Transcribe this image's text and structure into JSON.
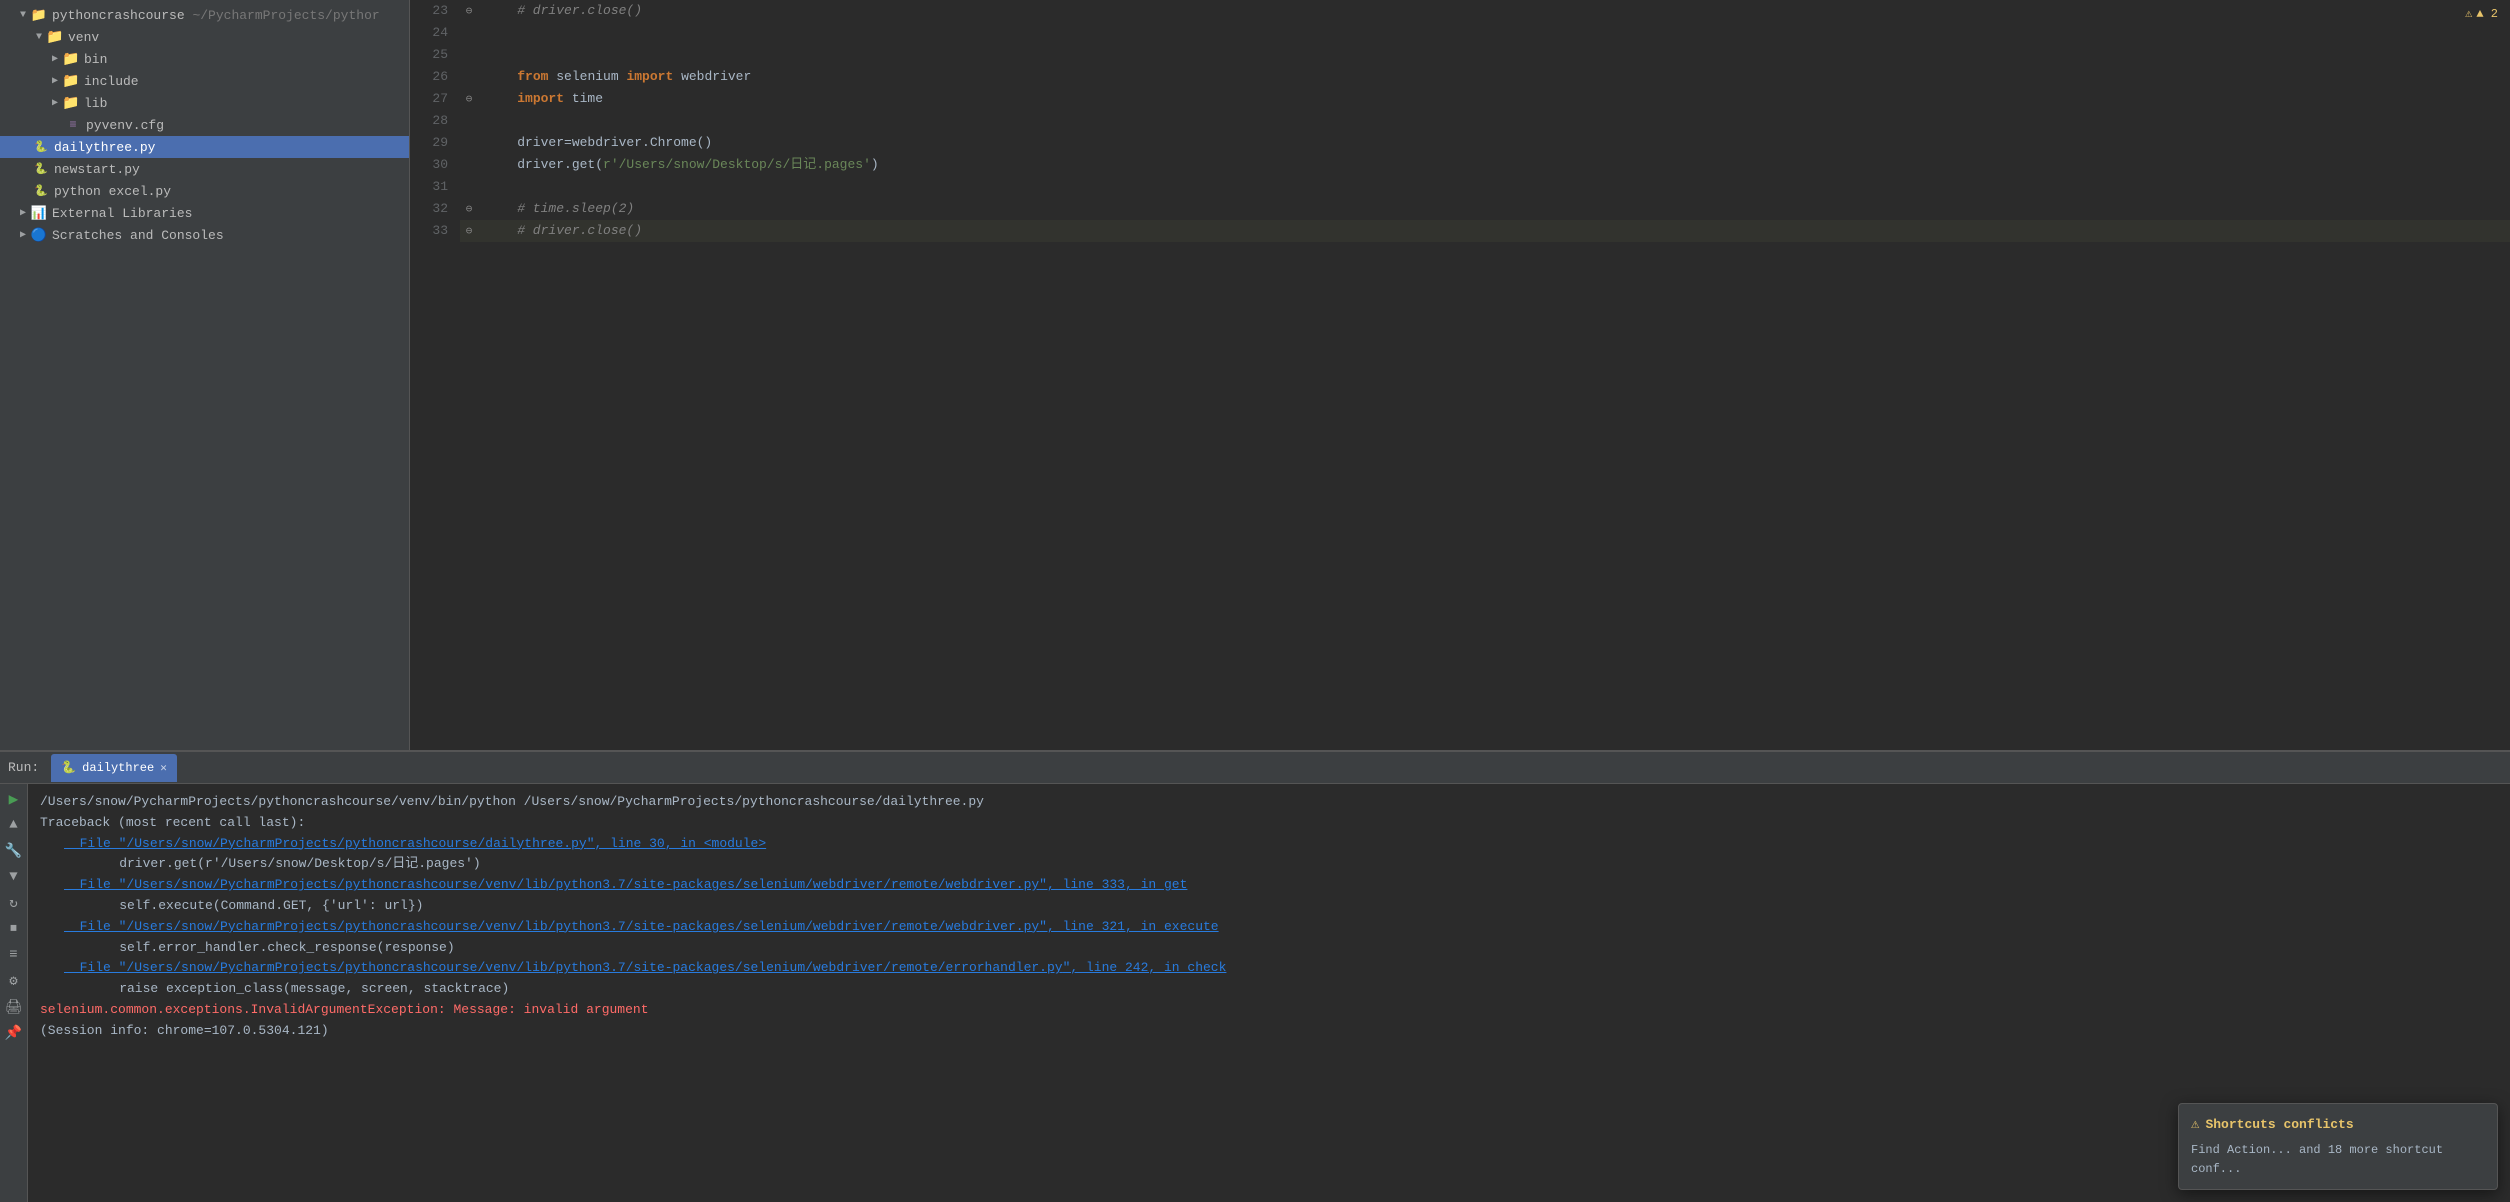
{
  "sidebar": {
    "project_name": "pythoncrashcourse",
    "project_path": "~/PycharmProjects/pythor",
    "items": [
      {
        "id": "pythoncrashcourse",
        "label": "pythoncrashcourse",
        "type": "project",
        "indent": 0,
        "expanded": true
      },
      {
        "id": "venv",
        "label": "venv",
        "type": "folder",
        "indent": 1,
        "expanded": true
      },
      {
        "id": "bin",
        "label": "bin",
        "type": "folder",
        "indent": 2,
        "expanded": false
      },
      {
        "id": "include",
        "label": "include",
        "type": "folder",
        "indent": 2,
        "expanded": false
      },
      {
        "id": "lib",
        "label": "lib",
        "type": "folder",
        "indent": 2,
        "expanded": false
      },
      {
        "id": "pyvenv.cfg",
        "label": "pyvenv.cfg",
        "type": "cfg",
        "indent": 2,
        "expanded": false
      },
      {
        "id": "dailythree.py",
        "label": "dailythree.py",
        "type": "py",
        "indent": 1,
        "active": true
      },
      {
        "id": "newstart.py",
        "label": "newstart.py",
        "type": "py",
        "indent": 1
      },
      {
        "id": "python excel.py",
        "label": "python excel.py",
        "type": "py",
        "indent": 1
      },
      {
        "id": "External Libraries",
        "label": "External Libraries",
        "type": "lib",
        "indent": 0,
        "expanded": false
      },
      {
        "id": "Scratches and Consoles",
        "label": "Scratches and Consoles",
        "type": "scratch",
        "indent": 0,
        "expanded": false
      }
    ]
  },
  "editor": {
    "lines": [
      {
        "num": 23,
        "gutter": "⊖",
        "content": "    # driver.close()",
        "type": "comment"
      },
      {
        "num": 24,
        "gutter": "",
        "content": "",
        "type": "plain"
      },
      {
        "num": 25,
        "gutter": "",
        "content": "",
        "type": "plain"
      },
      {
        "num": 26,
        "gutter": "",
        "content": "    from selenium import webdriver",
        "type": "code"
      },
      {
        "num": 27,
        "gutter": "⊖",
        "content": "    import time",
        "type": "code"
      },
      {
        "num": 28,
        "gutter": "",
        "content": "",
        "type": "plain"
      },
      {
        "num": 29,
        "gutter": "",
        "content": "    driver=webdriver.Chrome()",
        "type": "code"
      },
      {
        "num": 30,
        "gutter": "",
        "content": "    driver.get(r'/Users/snow/Desktop/s/日记.pages')",
        "type": "code"
      },
      {
        "num": 31,
        "gutter": "",
        "content": "",
        "type": "plain"
      },
      {
        "num": 32,
        "gutter": "⊖",
        "content": "    # time.sleep(2)",
        "type": "comment"
      },
      {
        "num": 33,
        "gutter": "⊖",
        "content": "    # driver.close()",
        "type": "comment",
        "highlighted": true
      }
    ]
  },
  "run_panel": {
    "label": "Run:",
    "tab_name": "dailythree",
    "output": [
      {
        "text": "/Users/snow/PycharmProjects/pythoncrashcourse/venv/bin/python /Users/snow/PycharmProjects/pythoncrashcourse/dailythree.py",
        "type": "plain"
      },
      {
        "text": "Traceback (most recent call last):",
        "type": "plain"
      },
      {
        "text": "  File \"/Users/snow/PycharmProjects/pythoncrashcourse/dailythree.py\", line 30, in <module>",
        "type": "error-path"
      },
      {
        "text": "    driver.get(r'/Users/snow/Desktop/s/日记.pages')",
        "type": "indented"
      },
      {
        "text": "  File \"/Users/snow/PycharmProjects/pythoncrashcourse/venv/lib/python3.7/site-packages/selenium/webdriver/remote/webdriver.py\", line 333, in get",
        "type": "error-path"
      },
      {
        "text": "    self.execute(Command.GET, {'url': url})",
        "type": "indented"
      },
      {
        "text": "  File \"/Users/snow/PycharmProjects/pythoncrashcourse/venv/lib/python3.7/site-packages/selenium/webdriver/remote/webdriver.py\", line 321, in execute",
        "type": "error-path"
      },
      {
        "text": "    self.error_handler.check_response(response)",
        "type": "indented"
      },
      {
        "text": "  File \"/Users/snow/PycharmProjects/pythoncrashcourse/venv/lib/python3.7/site-packages/selenium/webdriver/remote/errorhandler.py\", line 242, in check",
        "type": "error-path"
      },
      {
        "text": "    raise exception_class(message, screen, stacktrace)",
        "type": "indented"
      },
      {
        "text": "selenium.common.exceptions.InvalidArgumentException: Message: invalid argument",
        "type": "error-text"
      },
      {
        "text": "(Session info: chrome=107.0.5304.121)",
        "type": "plain"
      }
    ]
  },
  "warning": {
    "badge": "▲ 2",
    "popup_title": "Shortcuts conflicts",
    "popup_text": "Find Action... and 18 more shortcut conf..."
  }
}
